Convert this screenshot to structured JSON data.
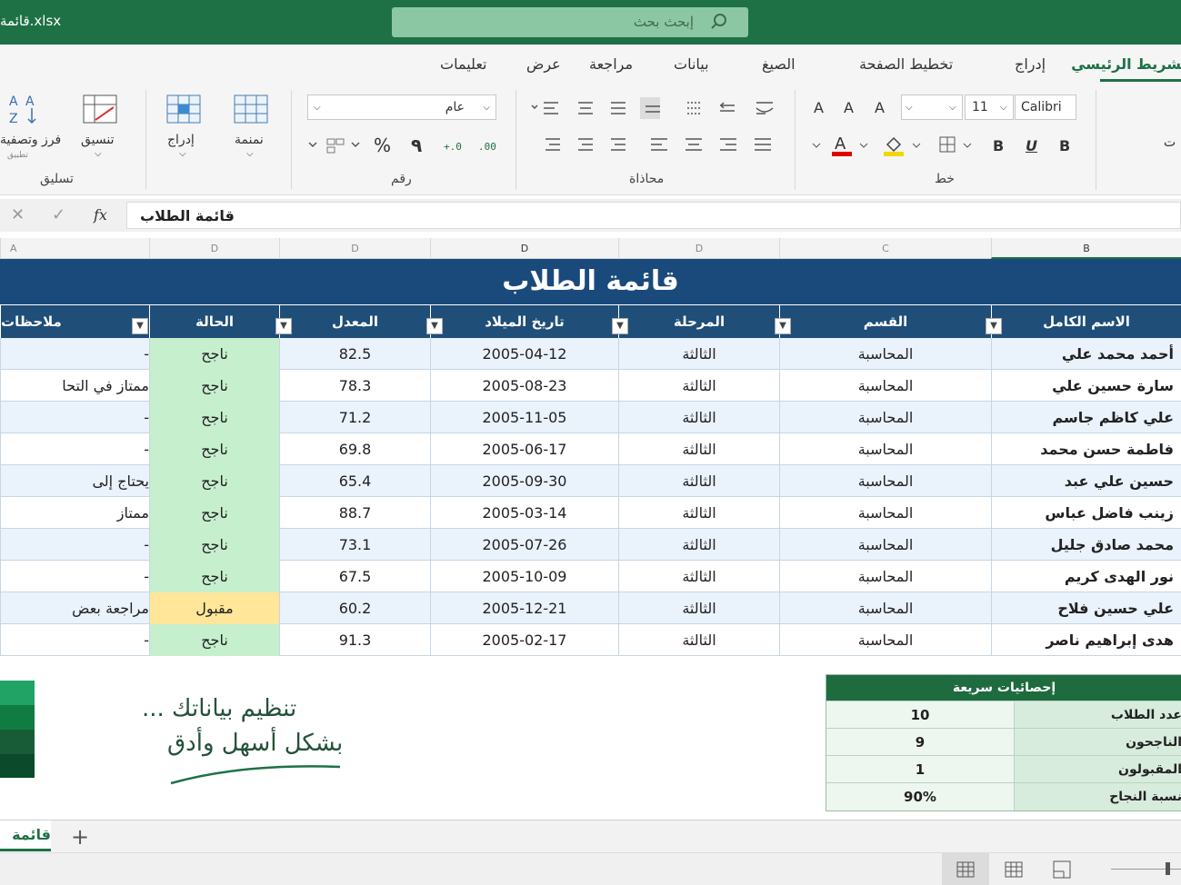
{
  "window": {
    "title": "قائمة.xlsx"
  },
  "search": {
    "placeholder": "إبحث بحث"
  },
  "ribbon": {
    "tabs": [
      "الشريط الرئيسي",
      "إدراج",
      "تخطيط الصفحة",
      "الصيغ",
      "بيانات",
      "مراجعة",
      "عرض",
      "تعليمات"
    ],
    "active_tab": "الشريط الرئيسي",
    "font": {
      "name": "Calibri",
      "size": "11",
      "group_label": "خط"
    },
    "alignment": {
      "group_label": "محاذاة"
    },
    "number": {
      "format": "عام",
      "group_label": "رقم",
      "percent": "%",
      "comma": "٩"
    },
    "cells": {
      "insert": "إدراج",
      "format": "تنسيق"
    },
    "styles": {
      "cell_styles": "نمنمة"
    },
    "editing": {
      "sort_filter": "فرز وتصفية",
      "group_label": "تسليق",
      "subtext": "تطبيق"
    },
    "partial_right": "ت"
  },
  "formula_bar": {
    "fx": "fx",
    "value": "قائمة الطلاب"
  },
  "columns": [
    "B",
    "C",
    "D",
    "D",
    "D",
    "D",
    "D",
    "A"
  ],
  "sheet": {
    "title": "قائمة الطلاب",
    "headers": [
      "الاسم الكامل",
      "القسم",
      "المرحلة",
      "تاريخ الميلاد",
      "المعدل",
      "الحالة",
      "ملاحظات"
    ],
    "rows": [
      {
        "name": "أحمد محمد علي",
        "dept": "المحاسبة",
        "stage": "الثالثة",
        "dob": "2005-04-12",
        "gpa": "82.5",
        "status": "ناجح",
        "note": "-"
      },
      {
        "name": "سارة حسين علي",
        "dept": "المحاسبة",
        "stage": "الثالثة",
        "dob": "2005-08-23",
        "gpa": "78.3",
        "status": "ناجح",
        "note": "ممتاز في التحا"
      },
      {
        "name": "علي كاظم جاسم",
        "dept": "المحاسبة",
        "stage": "الثالثة",
        "dob": "2005-11-05",
        "gpa": "71.2",
        "status": "ناجح",
        "note": "-"
      },
      {
        "name": "فاطمة حسن محمد",
        "dept": "المحاسبة",
        "stage": "الثالثة",
        "dob": "2005-06-17",
        "gpa": "69.8",
        "status": "ناجح",
        "note": "-"
      },
      {
        "name": "حسين علي عبد",
        "dept": "المحاسبة",
        "stage": "الثالثة",
        "dob": "2005-09-30",
        "gpa": "65.4",
        "status": "ناجح",
        "note": "يحتاج إلى"
      },
      {
        "name": "زينب فاضل عباس",
        "dept": "المحاسبة",
        "stage": "الثالثة",
        "dob": "2005-03-14",
        "gpa": "88.7",
        "status": "ناجح",
        "note": "ممتاز"
      },
      {
        "name": "محمد صادق جليل",
        "dept": "المحاسبة",
        "stage": "الثالثة",
        "dob": "2005-07-26",
        "gpa": "73.1",
        "status": "ناجح",
        "note": "-"
      },
      {
        "name": "نور الهدى كريم",
        "dept": "المحاسبة",
        "stage": "الثالثة",
        "dob": "2005-10-09",
        "gpa": "67.5",
        "status": "ناجح",
        "note": "-"
      },
      {
        "name": "علي حسين فلاح",
        "dept": "المحاسبة",
        "stage": "الثالثة",
        "dob": "2005-12-21",
        "gpa": "60.2",
        "status": "مقبول",
        "note": "مراجعة بعض"
      },
      {
        "name": "هدى إبراهيم ناصر",
        "dept": "المحاسبة",
        "stage": "الثالثة",
        "dob": "2005-02-17",
        "gpa": "91.3",
        "status": "ناجح",
        "note": "-"
      }
    ]
  },
  "stats": {
    "title": "إحصائيات سريعة",
    "rows": [
      {
        "label": "عدد الطلاب",
        "value": "10"
      },
      {
        "label": "الناجحون",
        "value": "9"
      },
      {
        "label": "المقبولون",
        "value": "1"
      },
      {
        "label": "نسبة النجاح",
        "value": "90%"
      }
    ]
  },
  "slogan": {
    "line1": "تنظيم بياناتك ...",
    "line2": "بشكل أسهل وأدق"
  },
  "sheet_tabs": {
    "active": "قائمة",
    "add": "+"
  },
  "colors": {
    "header_green": "#1e7145",
    "table_header": "#1f4e79",
    "pass": "#c6efce",
    "accepted": "#ffe699",
    "row_alt": "#eaf2fb"
  }
}
